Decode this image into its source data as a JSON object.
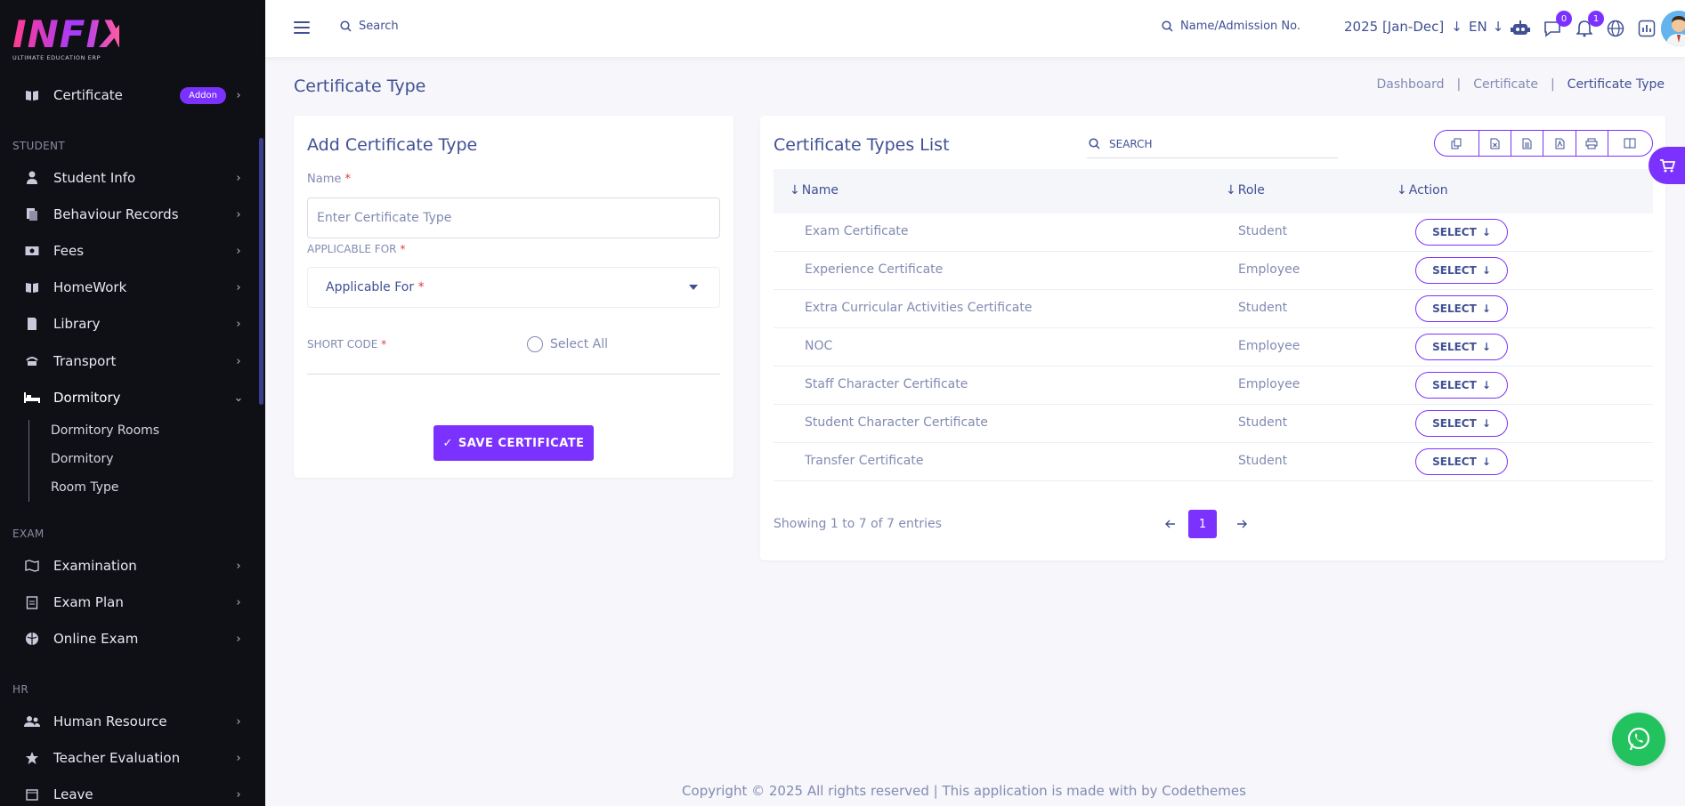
{
  "brand": {
    "logo_text": "INFIX",
    "logo_sub": "ULTIMATE EDUCATION ERP"
  },
  "sidebar": {
    "top_item": {
      "label": "Certificate",
      "badge": "Addon"
    },
    "sections": {
      "student": "STUDENT",
      "exam": "EXAM",
      "hr": "HR"
    },
    "student_items": [
      {
        "label": "Student Info",
        "icon": "user-icon"
      },
      {
        "label": "Behaviour Records",
        "icon": "records-icon"
      },
      {
        "label": "Fees",
        "icon": "money-icon"
      },
      {
        "label": "HomeWork",
        "icon": "book-icon"
      },
      {
        "label": "Library",
        "icon": "library-icon"
      },
      {
        "label": "Transport",
        "icon": "bus-icon"
      },
      {
        "label": "Dormitory",
        "icon": "bed-icon"
      }
    ],
    "dormitory_sub": [
      "Dormitory Rooms",
      "Dormitory",
      "Room Type"
    ],
    "exam_items": [
      {
        "label": "Examination",
        "icon": "map-icon"
      },
      {
        "label": "Exam Plan",
        "icon": "clipboard-icon"
      },
      {
        "label": "Online Exam",
        "icon": "globe-icon"
      }
    ],
    "hr_items": [
      {
        "label": "Human Resource",
        "icon": "users-icon"
      },
      {
        "label": "Teacher Evaluation",
        "icon": "star-icon"
      },
      {
        "label": "Leave",
        "icon": "calendar-icon"
      }
    ]
  },
  "topbar": {
    "search_label": "Search",
    "admission_search": "Name/Admission No.",
    "year": "2025 [Jan-Dec]",
    "lang": "EN",
    "messages_count": "0",
    "notifications_count": "1"
  },
  "page": {
    "title": "Certificate Type",
    "breadcrumb": [
      "Dashboard",
      "Certificate",
      "Certificate Type"
    ]
  },
  "form": {
    "title": "Add Certificate Type",
    "name_label": "Name",
    "name_placeholder": "Enter Certificate Type",
    "applicable_label": "APPLICABLE FOR",
    "applicable_select": "Applicable For",
    "short_code_label": "SHORT CODE",
    "select_all": "Select All",
    "save_button": "SAVE CERTIFICATE",
    "required_mark": "*"
  },
  "list": {
    "title": "Certificate Types List",
    "search_placeholder": "SEARCH",
    "columns": [
      "Name",
      "Role",
      "Action"
    ],
    "rows": [
      {
        "name": "Exam Certificate",
        "role": "Student",
        "action": "SELECT"
      },
      {
        "name": "Experience Certificate",
        "role": "Employee",
        "action": "SELECT"
      },
      {
        "name": "Extra Curricular Activities Certificate",
        "role": "Student",
        "action": "SELECT"
      },
      {
        "name": "NOC",
        "role": "Employee",
        "action": "SELECT"
      },
      {
        "name": "Staff Character Certificate",
        "role": "Employee",
        "action": "SELECT"
      },
      {
        "name": "Student Character Certificate",
        "role": "Student",
        "action": "SELECT"
      },
      {
        "name": "Transfer Certificate",
        "role": "Student",
        "action": "SELECT"
      }
    ],
    "showing": "Showing 1 to 7 of 7 entries",
    "current_page": "1"
  },
  "footer": "Copyright © 2025 All rights reserved | This application is made with by Codethemes",
  "colors": {
    "accent": "#7c32ff",
    "text": "#415094",
    "muted": "#828bb2",
    "sidebar_bg": "#0f1016",
    "whatsapp": "#22c35e"
  }
}
